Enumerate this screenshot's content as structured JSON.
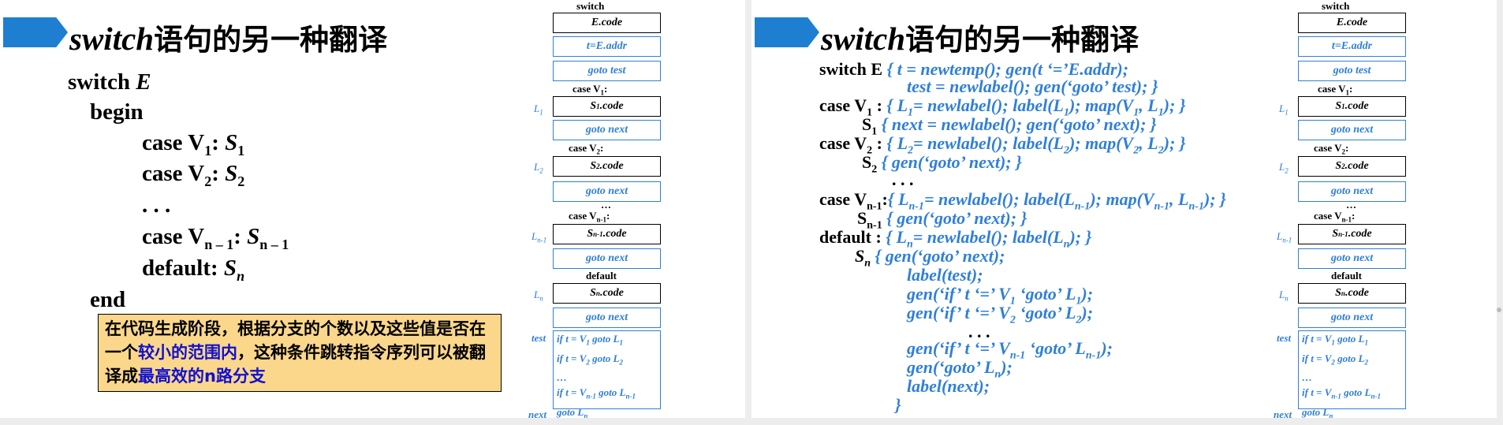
{
  "slide_left": {
    "title_kw": "switch",
    "title_zh": "语句的另一种翻译",
    "code": {
      "switch_kw": "switch",
      "switch_var": "E",
      "begin": "begin",
      "case1_kw": "case V",
      "case1_sub": "1",
      "case1_colon": ":",
      "case1_stmt": "S",
      "case1_stmt_sub": "1",
      "case2_kw": "case V",
      "case2_sub": "2",
      "case2_colon": ":",
      "case2_stmt": "S",
      "case2_stmt_sub": "2",
      "ellipsis": ". . .",
      "casen_kw": "case V",
      "casen_sub": "n – 1",
      "casen_colon": ":",
      "casen_stmt": "S",
      "casen_stmt_sub": "n – 1",
      "default_kw": "default:",
      "default_stmt": "S",
      "default_sub": "n",
      "end": "end"
    },
    "note": {
      "part1": "在代码生成阶段，根据分支的个数以及这些值是否在一个",
      "hl1": "较小的范围内",
      "part2": "，这种条件跳转指令序列可以被翻译成",
      "hl2": "最高效的n路分支"
    }
  },
  "diagram": {
    "switch_label": "switch",
    "ecode": "E.code",
    "t_assign": "t=E.addr",
    "goto_test": "goto test",
    "case1_label": "case V",
    "case1_sub": "1",
    "case1_colon": ":",
    "l1": "L",
    "l1_sub": "1",
    "s1_code": "S",
    "s1_sub": "1",
    "s1_suffix": ".code",
    "goto_next": "goto next",
    "case2_label": "case V",
    "case2_sub": "2",
    "case2_colon": ":",
    "l2": "L",
    "l2_sub": "2",
    "s2_code": "S",
    "s2_sub": "2",
    "s2_suffix": ".code",
    "dots": "…",
    "casen_label": "case V",
    "casen_sub": "n-1",
    "casen_colon": ":",
    "ln1": "L",
    "ln1_sub": "n-1",
    "sn1_code": "S",
    "sn1_sub": "n-1",
    "sn1_suffix": ".code",
    "default_label": "default",
    "ln": "L",
    "ln_sub": "n",
    "sn_code": "S",
    "sn_sub": "n",
    "sn_suffix": ".code",
    "test_label": "test",
    "test_lines": {
      "l1a": "if t = V",
      "l1b": "1",
      "l1c": " goto L",
      "l1d": "1",
      "l2a": "if t = V",
      "l2b": "2",
      "l2c": " goto L",
      "l2d": "2",
      "l3": "…",
      "l4a": "if t = V",
      "l4b": "n-1",
      "l4c": " goto L",
      "l4d": "n-1",
      "l5a": "goto L",
      "l5b": "n"
    },
    "next_label": "next"
  },
  "slide_right": {
    "title_kw": "switch",
    "title_zh": "语句的另一种翻译",
    "code": {
      "r1_kw": "switch E",
      "r1_act": "{ t = newtemp(); gen(t ‘=’E.addr);",
      "r2_act": "test = newlabel(); gen(‘goto’ test); }",
      "r3_kw": "case V",
      "r3_sub": "1",
      "r3_colon": " :",
      "r3_a": "{ L",
      "r3_b": "1",
      "r3_c": "= newlabel(); label(L",
      "r3_d": "1",
      "r3_e": "); map(V",
      "r3_f": "1",
      "r3_g": ", L",
      "r3_h": "1",
      "r3_i": "); }",
      "r4_kw": "S",
      "r4_sub": "1",
      "r4_act": "{ next = newlabel();  gen(‘goto’ next); }",
      "r5_kw": "case V",
      "r5_sub": "2",
      "r5_colon": " :",
      "r5_a": "{ L",
      "r5_b": "2",
      "r5_c": "= newlabel(); label(L",
      "r5_d": "2",
      "r5_e": "); map(V",
      "r5_f": "2",
      "r5_g": ", L",
      "r5_h": "2",
      "r5_i": "); }",
      "r6_kw": "S",
      "r6_sub": "2",
      "r6_act": "{ gen(‘goto’ next); }",
      "r7": ". . .",
      "r8_kw": "case V",
      "r8_sub": "n-1",
      "r8_colon": ":",
      "r8_a": "{ L",
      "r8_b": "n-1",
      "r8_c": "= newlabel(); label(L",
      "r8_d": "n-1",
      "r8_e": "); map(V",
      "r8_f": "n-1",
      "r8_g": ", L",
      "r8_h": "n-1",
      "r8_i": "); }",
      "r9_kw": "S",
      "r9_sub": "n-1",
      "r9_act": "{ gen(‘goto’ next); }",
      "r10_kw": "default :",
      "r10_a": "{ L",
      "r10_b": "n",
      "r10_c": "= newlabel(); label(L",
      "r10_d": "n",
      "r10_e": "); }",
      "r11_kw": "S",
      "r11_sub": "n",
      "r11_act": "{ gen(‘goto’ next);",
      "r12": "label(test);",
      "r13_a": "gen(‘if’ t ‘=’ V",
      "r13_b": "1",
      "r13_c": " ‘goto’ L",
      "r13_d": "1",
      "r13_e": ");",
      "r14_a": "gen(‘if’ t ‘=’ V",
      "r14_b": "2",
      "r14_c": " ‘goto’ L",
      "r14_d": "2",
      "r14_e": ");",
      "r15": ". . .",
      "r16_a": "gen(‘if’ t ‘=’ V",
      "r16_b": "n-1",
      "r16_c": " ‘goto’ L",
      "r16_d": "n-1",
      "r16_e": ");",
      "r17_a": "gen(‘goto’ L",
      "r17_b": "n",
      "r17_c": ");",
      "r18": "label(next);",
      "r19": "}"
    }
  }
}
